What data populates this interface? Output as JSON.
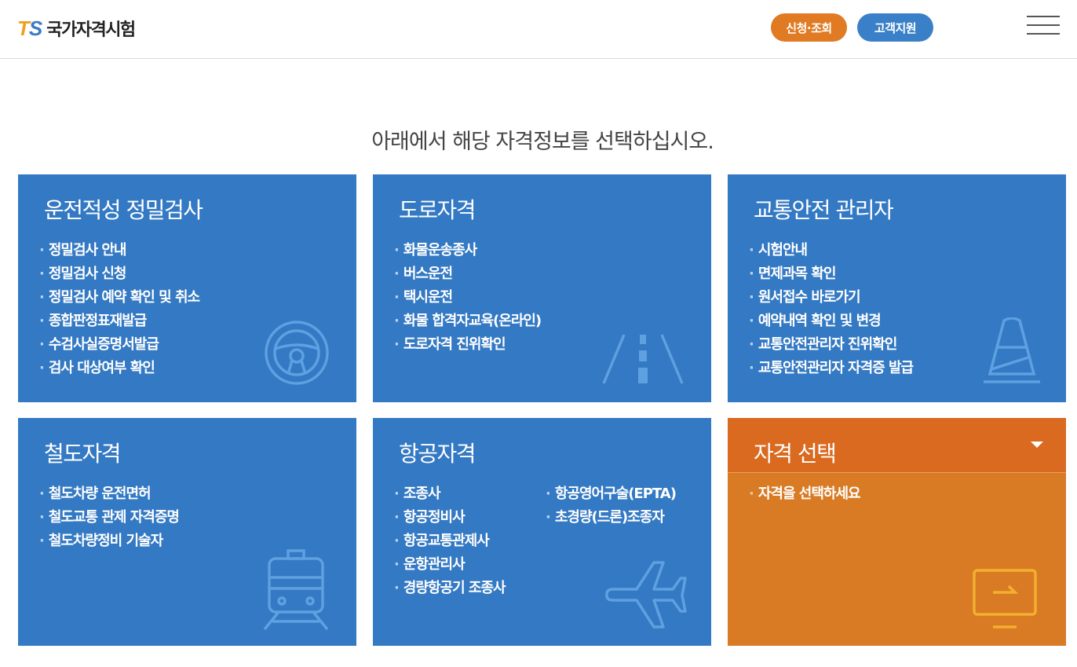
{
  "header": {
    "logo_mark_t": "T",
    "logo_mark_s": "S",
    "logo_text": "국가자격시험",
    "apply_button": "신청·조회",
    "support_button": "고객지원"
  },
  "intro_text": "아래에서 해당 자격정보를 선택하십시오.",
  "cards": [
    {
      "title": "운전적성 정밀검사",
      "items": [
        "정밀검사 안내",
        "정밀검사 신청",
        "정밀검사 예약 확인 및 취소",
        "종합판정표재발급",
        "수검사실증명서발급",
        "검사 대상여부 확인"
      ],
      "icon": "steering-wheel-icon"
    },
    {
      "title": "도로자격",
      "items": [
        "화물운송종사",
        "버스운전",
        "택시운전",
        "화물 합격자교육(온라인)",
        "도로자격 진위확인"
      ],
      "icon": "road-icon"
    },
    {
      "title": "교통안전 관리자",
      "items": [
        "시험안내",
        "면제과목 확인",
        "원서접수 바로가기",
        "예약내역 확인 및 변경",
        "교통안전관리자 진위확인",
        "교통안전관리자 자격증 발급"
      ],
      "icon": "traffic-cone-icon"
    },
    {
      "title": "철도자격",
      "items": [
        "철도차량 운전면허",
        "철도교통 관제 자격증명",
        "철도차량정비 기술자"
      ],
      "icon": "train-icon"
    },
    {
      "title": "항공자격",
      "items_left": [
        "조종사",
        "항공정비사",
        "항공교통관제사",
        "운항관리사",
        "경량항공기 조종사"
      ],
      "items_right": [
        "항공영어구술(EPTA)",
        "초경량(드론)조종자"
      ],
      "icon": "airplane-icon"
    },
    {
      "title": "자격 선택",
      "items": [
        "자격을 선택하세요"
      ],
      "icon": "monitor-icon"
    }
  ],
  "colors": {
    "card_blue": "#3479c3",
    "card_orange": "#d87b24",
    "select_bar": "#d96a20",
    "pill_orange": "#e07a23",
    "pill_blue": "#3a80c8"
  }
}
